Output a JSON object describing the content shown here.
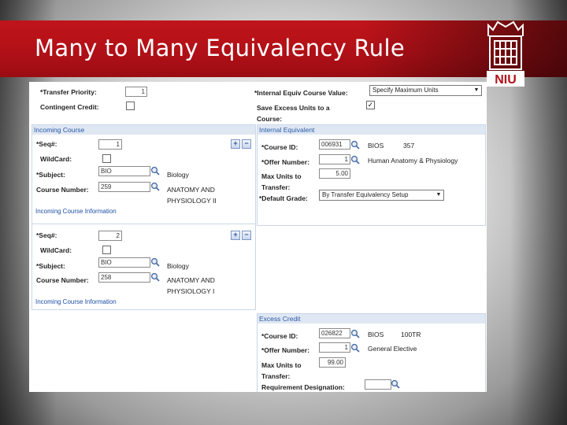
{
  "slide": {
    "title": "Many to Many Equivalency Rule",
    "logo_text": "NIU"
  },
  "form": {
    "transfer_priority": {
      "label": "*Transfer Priority:",
      "value": "1"
    },
    "contingent_credit": {
      "label": "Contingent Credit:",
      "checked": false
    },
    "internal_equiv_value": {
      "label": "*Internal Equiv Course Value:",
      "value": "Specify Maximum Units"
    },
    "save_excess": {
      "label_line1": "Save Excess Units to a",
      "label_line2": "Course:",
      "checked": true
    }
  },
  "incoming_course": {
    "header": "Incoming Course",
    "rows": [
      {
        "seq_label": "*Seq#:",
        "seq": "1",
        "wildcard_label": "WildCard:",
        "subject_label": "*Subject:",
        "subject": "BIO",
        "subject_desc": "Biology",
        "course_label": "Course Number:",
        "course_number": "259",
        "desc_line1": "ANATOMY AND",
        "desc_line2": "PHYSIOLOGY II",
        "link": "Incoming Course Information"
      },
      {
        "seq_label": "*Seq#:",
        "seq": "2",
        "wildcard_label": "WildCard:",
        "subject_label": "*Subject:",
        "subject": "BIO",
        "subject_desc": "Biology",
        "course_label": "Course Number:",
        "course_number": "258",
        "desc_line1": "ANATOMY AND",
        "desc_line2": "PHYSIOLOGY I",
        "link": "Incoming Course Information"
      }
    ]
  },
  "internal_equivalent": {
    "header": "Internal Equivalent",
    "course_id_label": "*Course ID:",
    "course_id": "006931",
    "subject": "BIOS",
    "catalog": "357",
    "offer_label": "*Offer Number:",
    "offer": "1",
    "offer_desc": "Human Anatomy & Physiology",
    "max_units_label_1": "Max Units to",
    "max_units_label_2": "Transfer:",
    "max_units": "5.00",
    "grade_label": "*Default Grade:",
    "grade": "By Transfer Equivalency Setup"
  },
  "excess_credit": {
    "header": "Excess Credit",
    "course_id_label": "*Course ID:",
    "course_id": "026822",
    "subject": "BIOS",
    "catalog": "100TR",
    "offer_label": "*Offer Number:",
    "offer": "1",
    "offer_desc": "General Elective",
    "max_units_label_1": "Max Units to",
    "max_units_label_2": "Transfer:",
    "max_units": "99.00",
    "req_label": "Requirement Designation:",
    "req": ""
  },
  "icons": {
    "plus": "+",
    "minus": "−",
    "check": "✓",
    "dropdown": "▼"
  },
  "colors": {
    "title_bar": "#b01017",
    "section_header_bg": "#dfe7f3",
    "section_header_text": "#2a5aa8",
    "link": "#1d4fa5"
  }
}
